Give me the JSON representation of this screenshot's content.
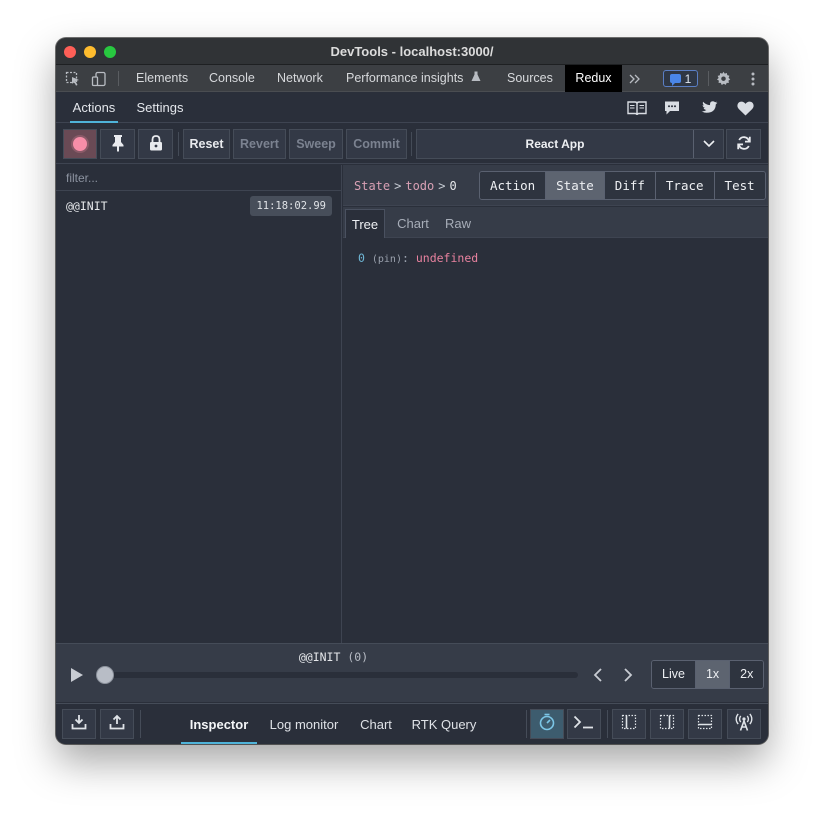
{
  "window": {
    "title": "DevTools - localhost:3000/"
  },
  "devtools_tabs": [
    {
      "label": "Elements"
    },
    {
      "label": "Console"
    },
    {
      "label": "Network"
    },
    {
      "label": "Performance insights"
    },
    {
      "label": "Sources"
    },
    {
      "label": "Redux",
      "active": true
    }
  ],
  "issues_badge": {
    "count": "1"
  },
  "redux_tabs": [
    {
      "label": "Actions",
      "active": true
    },
    {
      "label": "Settings"
    }
  ],
  "toolbar": {
    "reset_label": "Reset",
    "revert_label": "Revert",
    "sweep_label": "Sweep",
    "commit_label": "Commit",
    "instance": "React App"
  },
  "filter": {
    "placeholder": "filter..."
  },
  "actions": [
    {
      "name": "@@INIT",
      "time": "11:18:02.99"
    }
  ],
  "breadcrumb": {
    "root": "State",
    "path1": "todo",
    "path2": "0"
  },
  "modes": [
    "Action",
    "State",
    "Diff",
    "Trace",
    "Test"
  ],
  "active_mode": "State",
  "sub_tabs": [
    "Tree",
    "Chart",
    "Raw"
  ],
  "tree": {
    "key": "0",
    "pin": "(pin)",
    "colon": ":",
    "value": "undefined"
  },
  "slider": {
    "action": "@@INIT",
    "index": "(0)",
    "progress": 0
  },
  "speed": [
    "Live",
    "1x",
    "2x"
  ],
  "active_speed": "1x",
  "monitors": [
    "Inspector",
    "Log monitor",
    "Chart",
    "RTK Query"
  ],
  "active_monitor": "Inspector",
  "colors": {
    "accent": "#4fb3d9",
    "record": "#f78ea8",
    "crumb": "#d8a0b4",
    "value": "#e8829f",
    "key": "#6fb7d6"
  }
}
